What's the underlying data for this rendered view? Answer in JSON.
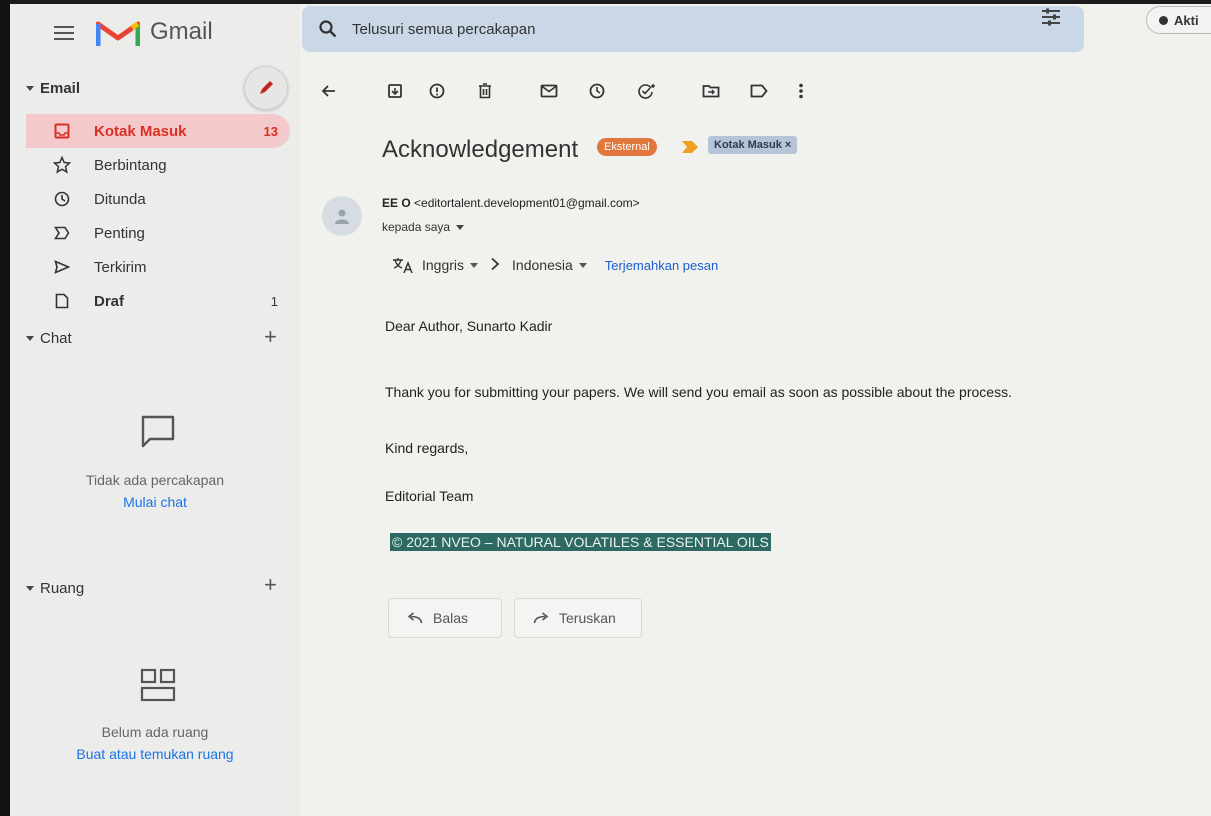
{
  "app": {
    "name": "Gmail"
  },
  "search": {
    "placeholder": "Telusuri semua percakapan"
  },
  "status": {
    "label": "Akti"
  },
  "sidebar": {
    "email_header": "Email",
    "items": [
      {
        "label": "Kotak Masuk",
        "count": "13"
      },
      {
        "label": "Berbintang",
        "count": ""
      },
      {
        "label": "Ditunda",
        "count": ""
      },
      {
        "label": "Penting",
        "count": ""
      },
      {
        "label": "Terkirim",
        "count": ""
      },
      {
        "label": "Draf",
        "count": "1"
      }
    ],
    "chat": {
      "header": "Chat",
      "empty_text": "Tidak ada percakapan",
      "link": "Mulai chat"
    },
    "rooms": {
      "header": "Ruang",
      "empty_text": "Belum ada ruang",
      "link": "Buat atau temukan ruang"
    }
  },
  "message": {
    "subject": "Acknowledgement",
    "external_badge": "Eksternal",
    "label_chip": "Kotak Masuk ×",
    "sender_name": "EE O",
    "sender_email": "<editortalent.development01@gmail.com>",
    "recipient": "kepada saya",
    "translate": {
      "from": "Inggris",
      "to": "Indonesia",
      "action": "Terjemahkan pesan"
    },
    "body": {
      "greeting": "Dear Author, Sunarto Kadir",
      "para1": "Thank you for submitting your papers. We will send you email as soon as possible about the process.",
      "regards": "Kind regards,",
      "signature": "Editorial Team",
      "footer": "© 2021 NVEO – NATURAL VOLATILES & ESSENTIAL OILS"
    },
    "reply_label": "Balas",
    "forward_label": "Teruskan"
  },
  "colors": {
    "accent_red": "#d93025",
    "active_bg": "#f4c9cb",
    "external_badge": "#e2773d",
    "label_chip": "#b6c4d8",
    "footer_highlight": "#2e6a63",
    "link_blue": "#1a73e8"
  },
  "icons": {
    "toolbar": [
      "back-arrow-icon",
      "archive-icon",
      "report-spam-icon",
      "delete-icon",
      "mark-unread-icon",
      "snooze-icon",
      "add-task-icon",
      "move-to-icon",
      "label-icon",
      "more-vert-icon"
    ]
  }
}
